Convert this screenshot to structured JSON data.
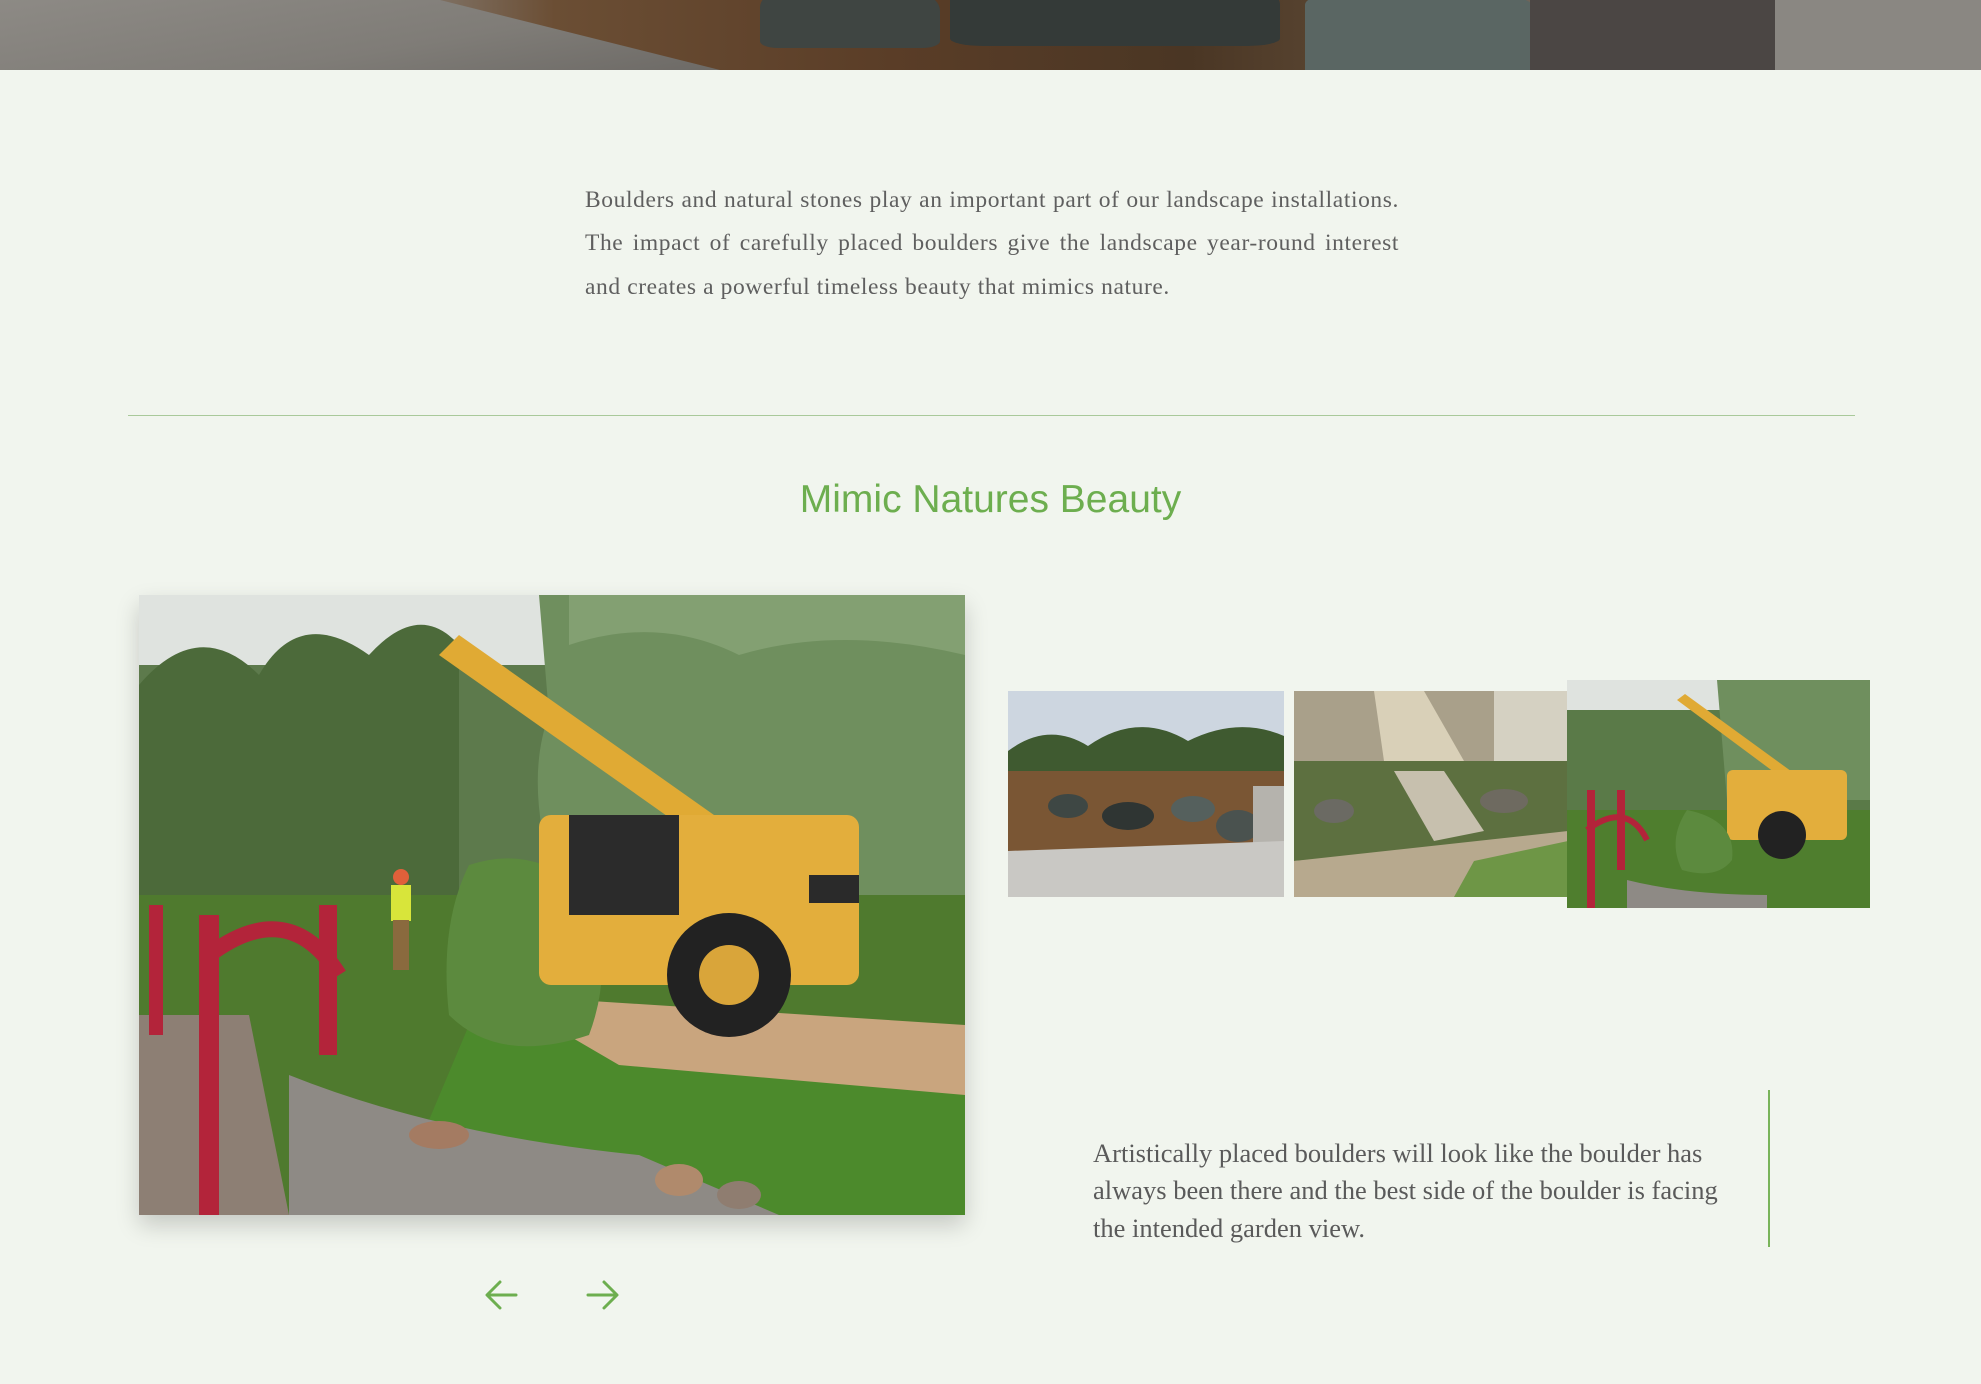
{
  "intro": {
    "text": "Boulders and natural stones play an important part of our landscape installations. The impact of carefully placed boulders give the landscape year-round interest and creates a powerful timeless beauty that mimics nature."
  },
  "section": {
    "title": "Mimic Natures Beauty"
  },
  "gallery": {
    "main_photo": "boulder-placement-crane-photo",
    "thumbnails": [
      "rock-garden-sidewalk-photo",
      "front-yard-steps-photo",
      "crane-garden-bridge-photo"
    ],
    "prev_icon": "arrow-left-icon",
    "next_icon": "arrow-right-icon"
  },
  "quote": {
    "text": "Artistically placed boulders will look like the boulder has always been there and the best side of the boulder is facing the intended garden view."
  },
  "colors": {
    "background": "#f1f5ee",
    "accent_green": "#6dae4f",
    "text": "#5f5f5f",
    "rule": "#a9c99a"
  }
}
